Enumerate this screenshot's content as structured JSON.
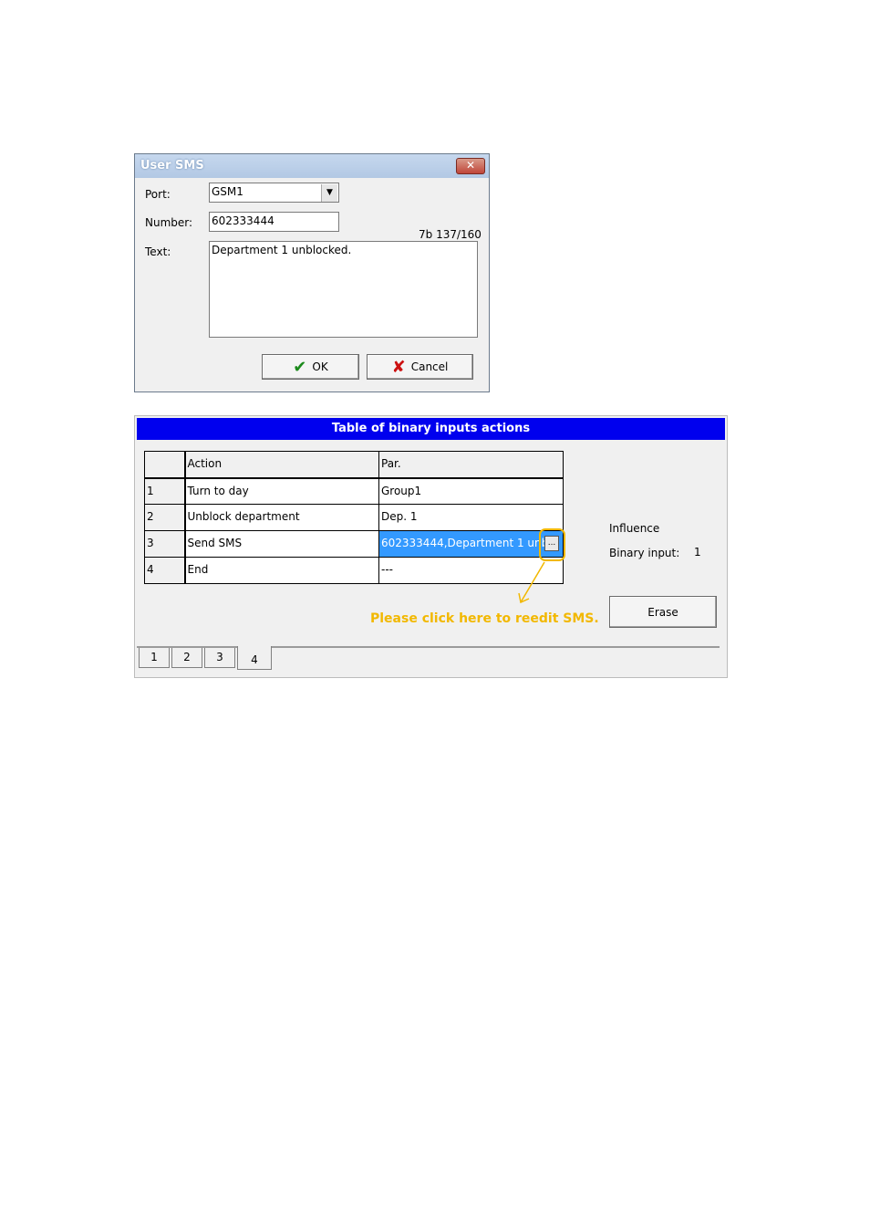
{
  "dialog": {
    "title": "User SMS",
    "close_glyph": "✕",
    "port_label": "Port:",
    "port_value": "GSM1",
    "number_label": "Number:",
    "number_value": "602333444",
    "counter": "7b 137/160",
    "text_label": "Text:",
    "text_value": "Department 1 unblocked.",
    "ok_label": "OK",
    "cancel_label": "Cancel"
  },
  "table_panel": {
    "title": "Table of binary inputs actions",
    "columns": [
      "",
      "Action",
      "Par."
    ],
    "rows": [
      {
        "num": "1",
        "action": "Turn to day",
        "par": "Group1"
      },
      {
        "num": "2",
        "action": "Unblock department",
        "par": "Dep. 1"
      },
      {
        "num": "3",
        "action": "Send SMS",
        "par": "602333444,Department 1 unbl"
      },
      {
        "num": "4",
        "action": "End",
        "par": "---"
      }
    ],
    "edit_glyph": "...",
    "influence_label": "Influence",
    "binary_input_label": "Binary input:",
    "binary_input_value": "1",
    "erase_label": "Erase",
    "hint": "Please click here to reedit SMS.",
    "tabs": [
      "1",
      "2",
      "3",
      "4"
    ],
    "active_tab": "4"
  },
  "colors": {
    "title_bar": "#0000ee",
    "selection": "#3399ff",
    "annotation": "#f2b800"
  }
}
